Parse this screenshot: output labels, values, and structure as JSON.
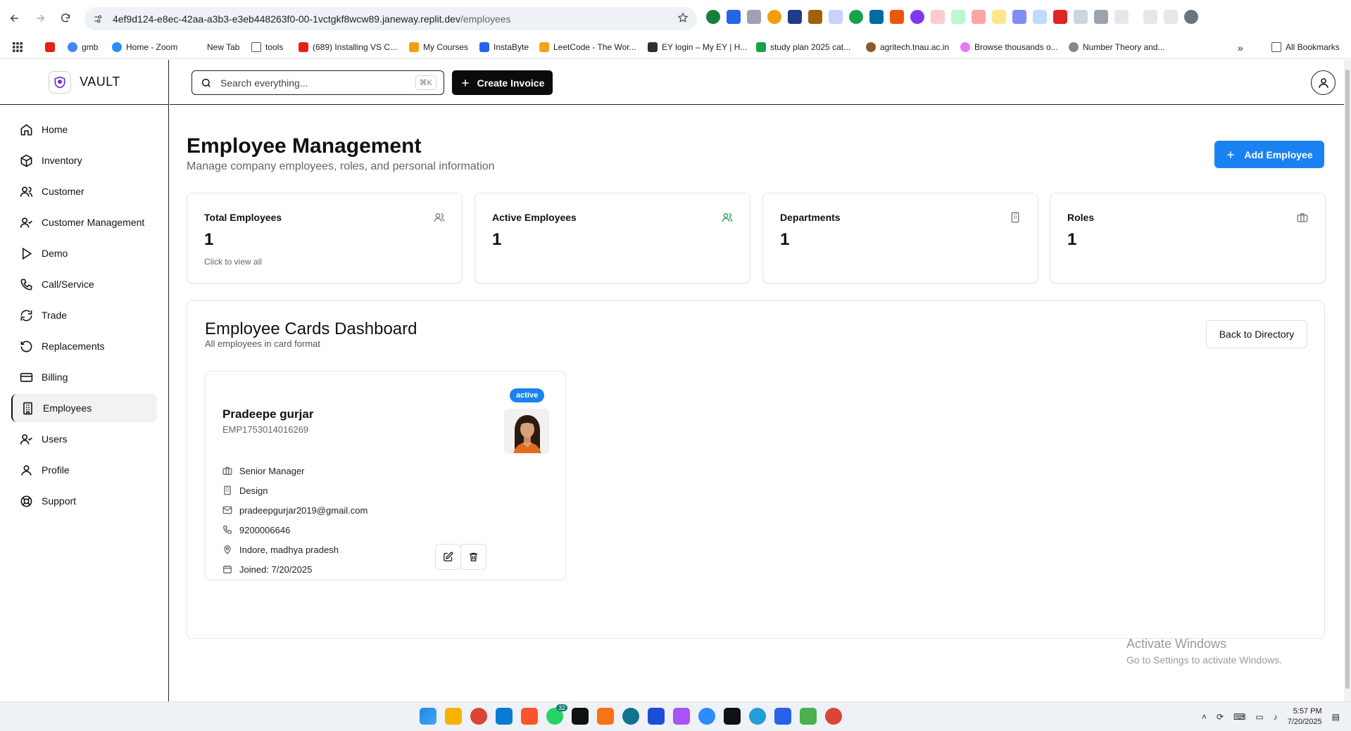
{
  "browser": {
    "url_host": "4ef9d124-e8ec-42aa-a3b3-e3eb448263f0-00-1vctgkf8wcw89.janeway.replit.dev",
    "url_path": "/employees",
    "bookmarks": [
      {
        "label": "",
        "icon": "youtube-icon",
        "color": "#e62117"
      },
      {
        "label": "gmb",
        "icon": "google-icon",
        "color": "#4285f4"
      },
      {
        "label": "Home - Zoom",
        "icon": "zoom-icon",
        "color": "#2d8cff"
      },
      {
        "label": "New Tab",
        "icon": "blank-page-icon",
        "color": "#ffffff"
      },
      {
        "label": "tools",
        "icon": "folder-icon",
        "color": "#ffffff"
      },
      {
        "label": "(689) Installing VS C...",
        "icon": "youtube-icon",
        "color": "#e62117"
      },
      {
        "label": "My Courses",
        "icon": "course-icon",
        "color": "#f59e0b"
      },
      {
        "label": "InstaByte",
        "icon": "instabyte-icon",
        "color": "#2563eb"
      },
      {
        "label": "LeetCode - The Wor...",
        "icon": "leetcode-icon",
        "color": "#f89f1b"
      },
      {
        "label": "EY login – My EY | H...",
        "icon": "ey-icon",
        "color": "#2e2e38"
      },
      {
        "label": "study plan 2025 cat...",
        "icon": "sheets-icon",
        "color": "#16a34a"
      },
      {
        "label": "agritech.tnau.ac.in",
        "icon": "tnau-icon",
        "color": "#8b5a2b"
      },
      {
        "label": "Browse thousands o...",
        "icon": "browse-icon",
        "color": "#e879f9"
      },
      {
        "label": "Number Theory and...",
        "icon": "globe-icon",
        "color": "#888888"
      }
    ],
    "all_bookmarks": "All Bookmarks"
  },
  "brand": {
    "name": "VAULT"
  },
  "nav": [
    {
      "label": "Home",
      "icon": "home-icon"
    },
    {
      "label": "Inventory",
      "icon": "package-icon"
    },
    {
      "label": "Customer",
      "icon": "users-icon"
    },
    {
      "label": "Customer Management",
      "icon": "user-check-icon"
    },
    {
      "label": "Demo",
      "icon": "play-icon"
    },
    {
      "label": "Call/Service",
      "icon": "phone-icon"
    },
    {
      "label": "Trade",
      "icon": "refresh-icon"
    },
    {
      "label": "Replacements",
      "icon": "rotate-ccw-icon"
    },
    {
      "label": "Billing",
      "icon": "credit-card-icon"
    },
    {
      "label": "Employees",
      "icon": "building-icon",
      "active": true
    },
    {
      "label": "Users",
      "icon": "user-check-icon"
    },
    {
      "label": "Profile",
      "icon": "user-icon"
    },
    {
      "label": "Support",
      "icon": "life-buoy-icon"
    }
  ],
  "topbar": {
    "search_placeholder": "Search everything...",
    "search_shortcut": "⌘K",
    "create_label": "Create Invoice"
  },
  "page": {
    "title": "Employee Management",
    "subtitle": "Manage company employees, roles, and personal information",
    "add_label": "Add Employee"
  },
  "stats": [
    {
      "label": "Total Employees",
      "value": "1",
      "hint": "Click to view all",
      "icon": "users-icon"
    },
    {
      "label": "Active Employees",
      "value": "1",
      "hint": "",
      "icon": "user-check-icon",
      "icon_color": "#16a34a"
    },
    {
      "label": "Departments",
      "value": "1",
      "hint": "",
      "icon": "building-icon"
    },
    {
      "label": "Roles",
      "value": "1",
      "hint": "",
      "icon": "briefcase-icon"
    }
  ],
  "dashboard": {
    "title": "Employee Cards Dashboard",
    "subtitle": "All employees in card format",
    "back_label": "Back to Directory"
  },
  "employee": {
    "status": "active",
    "name": "Pradeepe gurjar",
    "id": "EMP1753014016269",
    "role": "Senior Manager",
    "department": "Design",
    "email": "pradeepgurjar2019@gmail.com",
    "phone": "9200006646",
    "location": "Indore, madhya pradesh",
    "joined": "Joined: 7/20/2025"
  },
  "watermark": {
    "line1": "Activate Windows",
    "line2": "Go to Settings to activate Windows."
  },
  "taskbar": {
    "time": "5:57 PM",
    "date": "7/20/2025",
    "whatsapp_badge": "32"
  },
  "colors": {
    "accent": "#1a82f0",
    "dark_button": "#0b0b0b",
    "success": "#16a34a"
  }
}
